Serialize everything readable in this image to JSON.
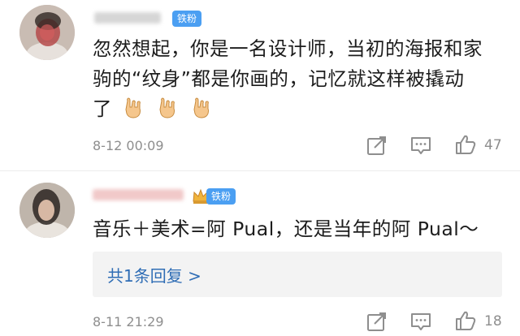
{
  "comments": [
    {
      "badge": "铁粉",
      "text_line1": "忽然想起，你是一名设计师，当初的海报和家",
      "text_line2": "驹的“纹身”都是你画的，记忆就这样被撬动",
      "text_line3": "了",
      "emoji": [
        "rock-on-hand-emoji",
        "rock-on-hand-emoji",
        "rock-on-hand-emoji"
      ],
      "timestamp": "8-12 00:09",
      "likes": "47"
    },
    {
      "badge": "铁粉",
      "text_line1": "音乐＋美术=阿 Pual，还是当年的阿 Pual～",
      "replies_label": "共1条回复 >",
      "timestamp": "8-11 21:29",
      "likes": "18"
    }
  ],
  "icons": {
    "share": "share-icon",
    "comment": "comment-icon",
    "like": "thumbs-up-icon"
  },
  "colors": {
    "badge": "#4b9ff2",
    "link": "#2f6db5",
    "meta": "#8e8e8e"
  }
}
